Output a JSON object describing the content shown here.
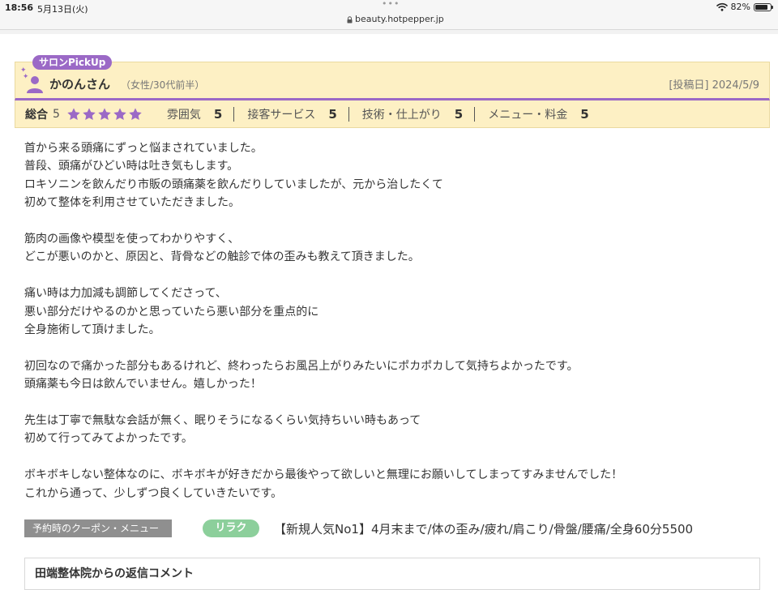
{
  "status_bar": {
    "time": "18:56",
    "date": "5月13日(火)",
    "url": "beauty.hotpepper.jp",
    "battery": "82%",
    "battery_level": 0.82
  },
  "review": {
    "badge": "サロンPickUp",
    "reviewer_name": "かのんさん",
    "reviewer_meta": "（女性/30代前半）",
    "post_date": "[投稿日] 2024/5/9",
    "overall_label": "総合",
    "overall_value": "5",
    "stars": 5,
    "accent_color": "#9b69c6",
    "ratings": [
      {
        "label": "雰囲気",
        "value": "5"
      },
      {
        "label": "接客サービス",
        "value": "5"
      },
      {
        "label": "技術・仕上がり",
        "value": "5"
      },
      {
        "label": "メニュー・料金",
        "value": "5"
      }
    ],
    "paragraphs": [
      [
        "首から来る頭痛にずっと悩まされていました。",
        "普段、頭痛がひどい時は吐き気もします。",
        "ロキソニンを飲んだり市販の頭痛薬を飲んだりしていましたが、元から治したくて",
        "初めて整体を利用させていただきました。"
      ],
      [
        "筋肉の画像や模型を使ってわかりやすく、",
        "どこが悪いのかと、原因と、背骨などの触診で体の歪みも教えて頂きました。"
      ],
      [
        "痛い時は力加減も調節してくださって、",
        "悪い部分だけやるのかと思っていたら悪い部分を重点的に",
        "全身施術して頂けました。"
      ],
      [
        "初回なので痛かった部分もあるけれど、終わったらお風呂上がりみたいにポカポカして気持ちよかったです。",
        "頭痛薬も今日は飲んでいません。嬉しかった！"
      ],
      [
        "先生は丁寧で無駄な会話が無く、眠りそうになるくらい気持ちいい時もあって",
        "初めて行ってみてよかったです。"
      ],
      [
        "ボキボキしない整体なのに、ボキボキが好きだから最後やって欲しいと無理にお願いしてしまってすみませんでした！",
        "これから通って、少しずつ良くしていきたいです。"
      ]
    ],
    "coupon_label": "予約時のクーポン・メニュー",
    "coupon_tag": "リラク",
    "coupon_text": "【新規人気No1】4月末まで/体の歪み/疲れ/肩こり/骨盤/腰痛/全身60分5500"
  },
  "reply": {
    "title": "田端整体院からの返信コメント"
  }
}
